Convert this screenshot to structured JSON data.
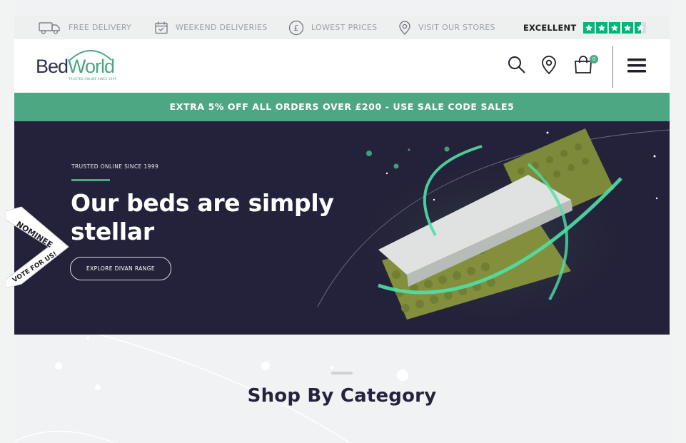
{
  "utility_bar": {
    "items": [
      {
        "icon": "delivery-truck-icon",
        "label": "FREE DELIVERY"
      },
      {
        "icon": "calendar-icon",
        "label": "WEEKEND DELIVERIES"
      },
      {
        "icon": "pound-coin-icon",
        "label": "LOWEST PRICES"
      },
      {
        "icon": "location-pin-icon",
        "label": "VISIT OUR STORES"
      }
    ],
    "trustpilot": {
      "label": "EXCELLENT",
      "stars": 4.5,
      "star_color": "#00b67a"
    }
  },
  "header": {
    "logo": {
      "bed": "Bed",
      "world": "World",
      "tagline": "TRUSTED ONLINE SINCE 1999"
    },
    "icons": [
      "search-icon",
      "location-pin-icon",
      "shopping-bag-icon",
      "hamburger-menu-icon"
    ],
    "cart_count": "0"
  },
  "promo": {
    "text": "EXTRA 5% OFF ALL ORDERS OVER £200 - USE SALE CODE SALE5",
    "color": "#4ea783"
  },
  "hero": {
    "tagline": "TRUSTED ONLINE SINCE 1999",
    "title": "Our beds are simply stellar",
    "button": "EXPLORE DIVAN RANGE",
    "background": "#24223a"
  },
  "ribbon": {
    "nominee": "NOMINEE",
    "vote": "VOTE FOR US!"
  },
  "category": {
    "title": "Shop By Category"
  },
  "colors": {
    "brand_green": "#4ea783",
    "brand_navy": "#2d2f52"
  }
}
